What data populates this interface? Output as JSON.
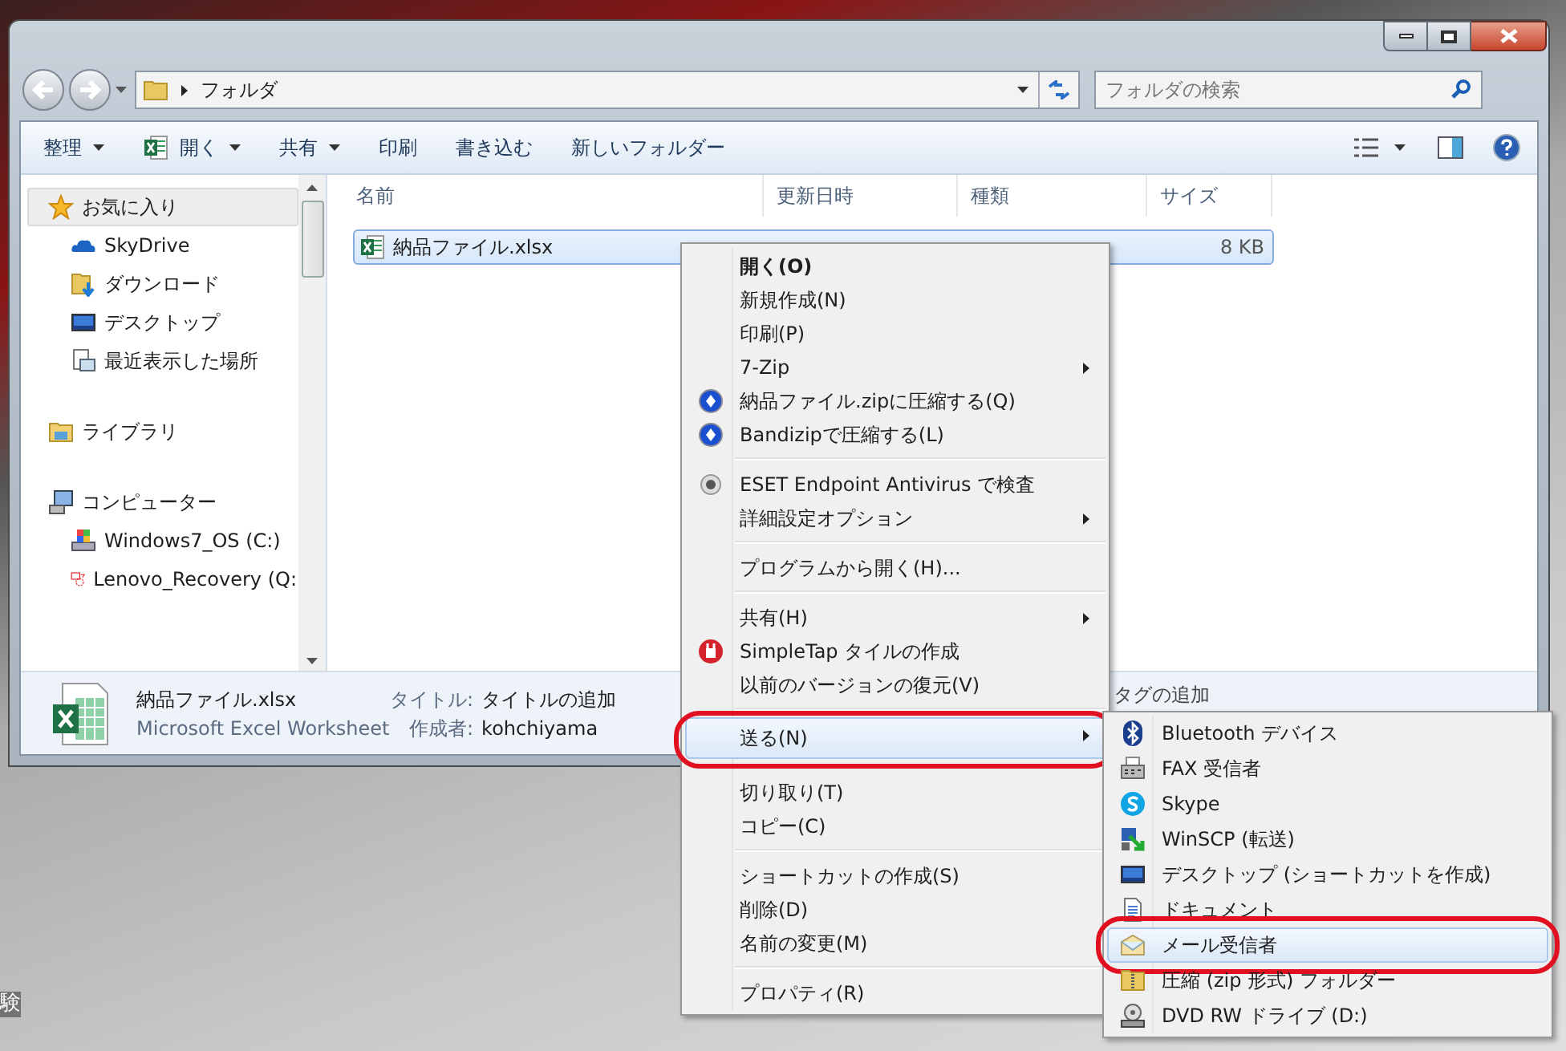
{
  "window": {
    "address": "フォルダ",
    "search": {
      "placeholder": "フォルダの検索"
    }
  },
  "toolbar": [
    {
      "label": "整理",
      "kind": "plain",
      "dropdown": true
    },
    {
      "label": "開く",
      "kind": "excel",
      "dropdown": true
    },
    {
      "label": "共有",
      "kind": "plain",
      "dropdown": true
    },
    {
      "label": "印刷",
      "kind": "plain",
      "dropdown": false
    },
    {
      "label": "書き込む",
      "kind": "plain",
      "dropdown": false
    },
    {
      "label": "新しいフォルダー",
      "kind": "plain",
      "dropdown": false
    }
  ],
  "nav": [
    {
      "label": "お気に入り",
      "kind": "star",
      "selected": true,
      "children": [
        {
          "label": "SkyDrive",
          "kind": "cloud",
          "selected": false
        },
        {
          "label": "ダウンロード",
          "kind": "download",
          "selected": false
        },
        {
          "label": "デスクトップ",
          "kind": "desktop",
          "selected": false
        },
        {
          "label": "最近表示した場所",
          "kind": "recent",
          "selected": false
        }
      ]
    },
    {
      "label": "ライブラリ",
      "kind": "library",
      "selected": false
    },
    {
      "label": "コンピューター",
      "kind": "computer",
      "selected": false,
      "children": [
        {
          "label": "Windows7_OS (C:)",
          "kind": "drive",
          "selected": false
        },
        {
          "label": "Lenovo_Recovery (Q:",
          "kind": "recovery",
          "selected": false
        }
      ]
    }
  ],
  "columns": [
    "名前",
    "更新日時",
    "種類",
    "サイズ"
  ],
  "files": [
    {
      "name": "納品ファイル.xlsx",
      "size": "8 KB",
      "selected": true
    }
  ],
  "details": {
    "name": "納品ファイル.xlsx",
    "type": "Microsoft Excel Worksheet",
    "fields": [
      {
        "label": "タイトル:",
        "value": "タイトルの追加"
      },
      {
        "label": "作成者:",
        "value": "kohchiyama"
      }
    ],
    "tags": "タグの追加"
  },
  "context_menu": {
    "groups": [
      [
        {
          "label": "開く(O)",
          "bold": true,
          "submenu": false,
          "kind": "none",
          "selected": false,
          "circled": false
        },
        {
          "label": "新規作成(N)",
          "bold": false,
          "submenu": false,
          "kind": "none",
          "selected": false,
          "circled": false
        },
        {
          "label": "印刷(P)",
          "bold": false,
          "submenu": false,
          "kind": "none",
          "selected": false,
          "circled": false
        },
        {
          "label": "7-Zip",
          "bold": false,
          "submenu": true,
          "kind": "none",
          "selected": false,
          "circled": false
        },
        {
          "label": "納品ファイル.zipに圧縮する(Q)",
          "bold": false,
          "submenu": false,
          "kind": "bandizip",
          "selected": false,
          "circled": false
        },
        {
          "label": "Bandizipで圧縮する(L)",
          "bold": false,
          "submenu": false,
          "kind": "bandizip",
          "selected": false,
          "circled": false
        }
      ],
      [
        {
          "label": "ESET Endpoint Antivirus で検査",
          "bold": false,
          "submenu": false,
          "kind": "eset",
          "selected": false,
          "circled": false
        },
        {
          "label": "詳細設定オプション",
          "bold": false,
          "submenu": true,
          "kind": "none",
          "selected": false,
          "circled": false
        }
      ],
      [
        {
          "label": "プログラムから開く(H)...",
          "bold": false,
          "submenu": false,
          "kind": "none",
          "selected": false,
          "circled": false
        }
      ],
      [
        {
          "label": "共有(H)",
          "bold": false,
          "submenu": true,
          "kind": "none",
          "selected": false,
          "circled": false
        },
        {
          "label": "SimpleTap タイルの作成",
          "bold": false,
          "submenu": false,
          "kind": "simpletap",
          "selected": false,
          "circled": false
        },
        {
          "label": "以前のバージョンの復元(V)",
          "bold": false,
          "submenu": false,
          "kind": "none",
          "selected": false,
          "circled": false
        }
      ],
      [
        {
          "label": "送る(N)",
          "bold": false,
          "submenu": true,
          "kind": "none",
          "selected": true,
          "circled": true
        }
      ],
      [
        {
          "label": "切り取り(T)",
          "bold": false,
          "submenu": false,
          "kind": "none",
          "selected": false,
          "circled": false
        },
        {
          "label": "コピー(C)",
          "bold": false,
          "submenu": false,
          "kind": "none",
          "selected": false,
          "circled": false
        }
      ],
      [
        {
          "label": "ショートカットの作成(S)",
          "bold": false,
          "submenu": false,
          "kind": "none",
          "selected": false,
          "circled": false
        },
        {
          "label": "削除(D)",
          "bold": false,
          "submenu": false,
          "kind": "none",
          "selected": false,
          "circled": false
        },
        {
          "label": "名前の変更(M)",
          "bold": false,
          "submenu": false,
          "kind": "none",
          "selected": false,
          "circled": false
        }
      ],
      [
        {
          "label": "プロパティ(R)",
          "bold": false,
          "submenu": false,
          "kind": "none",
          "selected": false,
          "circled": false
        }
      ]
    ]
  },
  "send_to_menu": {
    "items": [
      {
        "label": "Bluetooth デバイス",
        "kind": "bluetooth",
        "selected": false,
        "circled": false
      },
      {
        "label": "FAX 受信者",
        "kind": "fax",
        "selected": false,
        "circled": false
      },
      {
        "label": "Skype",
        "kind": "skype",
        "selected": false,
        "circled": false
      },
      {
        "label": "WinSCP (転送)",
        "kind": "winscp",
        "selected": false,
        "circled": false
      },
      {
        "label": "デスクトップ (ショートカットを作成)",
        "kind": "desktop",
        "selected": false,
        "circled": false
      },
      {
        "label": "ドキュメント",
        "kind": "document",
        "selected": false,
        "circled": false
      },
      {
        "label": "メール受信者",
        "kind": "mail",
        "selected": true,
        "circled": true
      },
      {
        "label": "圧縮 (zip 形式) フォルダー",
        "kind": "zip",
        "selected": false,
        "circled": false
      },
      {
        "label": "DVD RW ドライブ (D:)",
        "kind": "dvd",
        "selected": false,
        "circled": false
      }
    ]
  },
  "desktop": {
    "label": "験"
  }
}
